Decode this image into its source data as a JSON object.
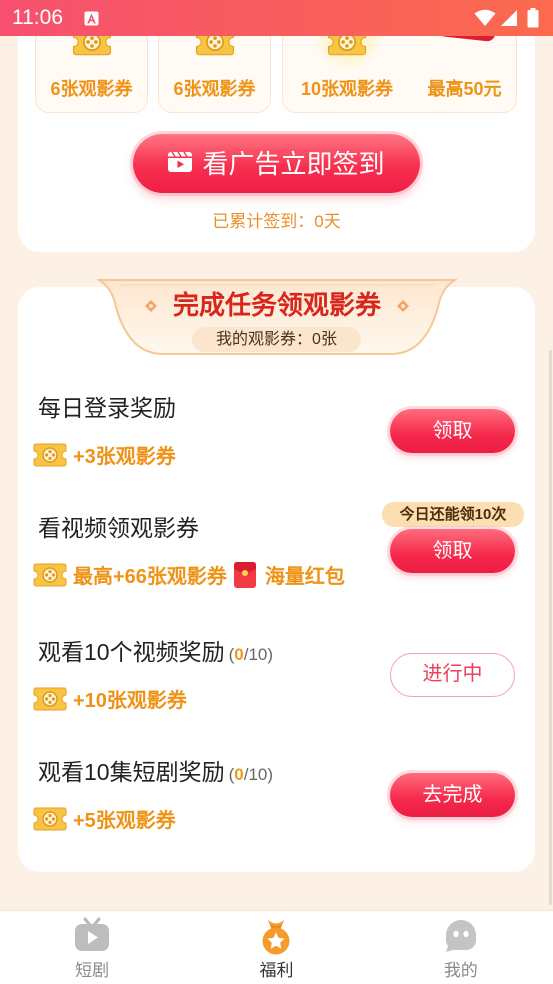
{
  "status_bar": {
    "time": "11:06",
    "icons": [
      "app-notification-icon",
      "wifi-icon",
      "signal-icon",
      "battery-icon"
    ]
  },
  "checkin_card": {
    "rewards": [
      {
        "label": "6张观影券",
        "icon": "ticket-icon"
      },
      {
        "label": "6张观影券",
        "icon": "ticket-icon"
      },
      {
        "label": "10张观影券",
        "icon": "ticket-glow-icon",
        "highlight": true
      },
      {
        "label": "最高50元",
        "icon": "red-packet-icon"
      }
    ],
    "button_label": "看广告立即签到",
    "button_icon": "video-play-icon",
    "streak_text": "已累计签到：0天"
  },
  "tasks_section": {
    "title": "完成任务领观影券",
    "my_tickets": "我的观影券：0张",
    "tasks": [
      {
        "title": "每日登录奖励",
        "rewards": [
          {
            "icon": "ticket-icon",
            "text": "+3张观影券"
          }
        ],
        "button": {
          "label": "领取",
          "style": "filled"
        }
      },
      {
        "title": "看视频领观影券",
        "badge": "今日还能领10次",
        "rewards": [
          {
            "icon": "ticket-icon",
            "text": "最高+66张观影券"
          },
          {
            "icon": "red-packet-icon",
            "text": "海量红包"
          }
        ],
        "button": {
          "label": "领取",
          "style": "filled"
        }
      },
      {
        "title": "观看10个视频奖励",
        "progress": {
          "prefix": "(",
          "current": "0",
          "suffix": "/10)"
        },
        "rewards": [
          {
            "icon": "ticket-icon",
            "text": "+10张观影券"
          }
        ],
        "button": {
          "label": "进行中",
          "style": "outline"
        }
      },
      {
        "title": "观看10集短剧奖励",
        "progress": {
          "prefix": "(",
          "current": "0",
          "suffix": "/10)"
        },
        "rewards": [
          {
            "icon": "ticket-icon",
            "text": "+5张观影券"
          }
        ],
        "button": {
          "label": "去完成",
          "style": "filled"
        }
      }
    ]
  },
  "bottom_nav": {
    "items": [
      {
        "label": "短剧",
        "icon": "tv-icon",
        "active": false
      },
      {
        "label": "福利",
        "icon": "welfare-bag-icon",
        "active": true
      },
      {
        "label": "我的",
        "icon": "ghost-avatar-icon",
        "active": false
      }
    ]
  },
  "colors": {
    "background": "#fdf1e5",
    "status_bar_start": "#f6506f",
    "status_bar_end": "#fb6a4e",
    "reward_orange": "#ef9317",
    "accent_red": "#f5294c"
  }
}
